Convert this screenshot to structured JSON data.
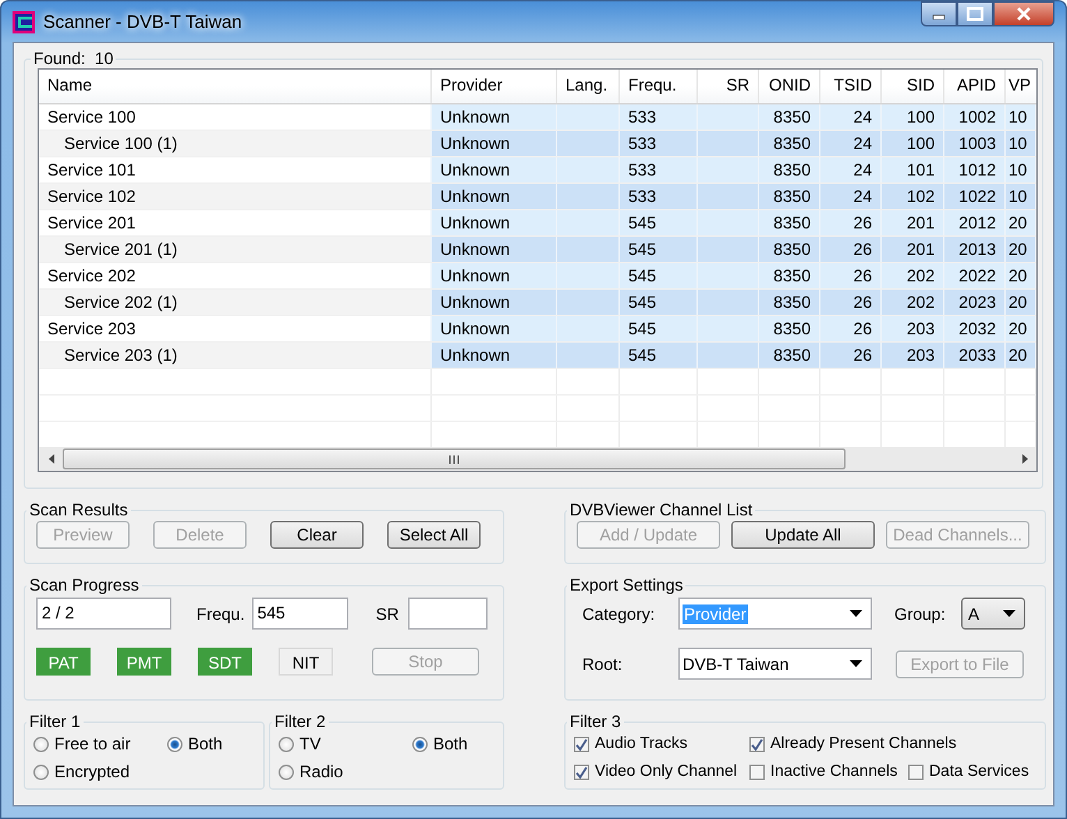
{
  "window": {
    "title": "Scanner - DVB-T Taiwan"
  },
  "found": {
    "label": "Found:",
    "count": "10"
  },
  "table": {
    "columns": [
      "Name",
      "Provider",
      "Lang.",
      "Frequ.",
      "SR",
      "ONID",
      "TSID",
      "SID",
      "APID",
      "VP"
    ],
    "rows": [
      {
        "cells": [
          "Service 100",
          "Unknown",
          "",
          "533",
          "",
          "8350",
          "24",
          "100",
          "1002",
          "10"
        ],
        "children": [
          {
            "cells": [
              "Service 100 (1)",
              "Unknown",
              "",
              "533",
              "",
              "8350",
              "24",
              "100",
              "1003",
              "10"
            ]
          }
        ]
      },
      {
        "cells": [
          "Service 101",
          "Unknown",
          "",
          "533",
          "",
          "8350",
          "24",
          "101",
          "1012",
          "10"
        ]
      },
      {
        "cells": [
          "Service 102",
          "Unknown",
          "",
          "533",
          "",
          "8350",
          "24",
          "102",
          "1022",
          "10"
        ]
      },
      {
        "cells": [
          "Service 201",
          "Unknown",
          "",
          "545",
          "",
          "8350",
          "26",
          "201",
          "2012",
          "20"
        ],
        "children": [
          {
            "cells": [
              "Service 201 (1)",
              "Unknown",
              "",
              "545",
              "",
              "8350",
              "26",
              "201",
              "2013",
              "20"
            ]
          }
        ]
      },
      {
        "cells": [
          "Service 202",
          "Unknown",
          "",
          "545",
          "",
          "8350",
          "26",
          "202",
          "2022",
          "20"
        ],
        "children": [
          {
            "cells": [
              "Service 202 (1)",
              "Unknown",
              "",
              "545",
              "",
              "8350",
              "26",
              "202",
              "2023",
              "20"
            ]
          }
        ]
      },
      {
        "cells": [
          "Service 203",
          "Unknown",
          "",
          "545",
          "",
          "8350",
          "26",
          "203",
          "2032",
          "20"
        ],
        "children": [
          {
            "cells": [
              "Service 203 (1)",
              "Unknown",
              "",
              "545",
              "",
              "8350",
              "26",
              "203",
              "2033",
              "20"
            ]
          }
        ]
      }
    ]
  },
  "scan_results": {
    "title": "Scan Results",
    "buttons": [
      {
        "label": "Preview",
        "disabled": true
      },
      {
        "label": "Delete",
        "disabled": true
      },
      {
        "label": "Clear",
        "disabled": false
      },
      {
        "label": "Select All",
        "disabled": false
      }
    ]
  },
  "channel_list": {
    "title": "DVBViewer Channel List",
    "buttons": [
      {
        "label": "Add / Update",
        "disabled": true
      },
      {
        "label": "Update All",
        "disabled": false
      },
      {
        "label": "Dead Channels...",
        "disabled": true
      }
    ]
  },
  "scan_progress": {
    "title": "Scan Progress",
    "progress": "2 / 2",
    "freq_label": "Frequ.",
    "freq_value": "545",
    "sr_label": "SR",
    "tables": [
      {
        "label": "PAT",
        "found": true
      },
      {
        "label": "PMT",
        "found": true
      },
      {
        "label": "SDT",
        "found": true
      },
      {
        "label": "NIT",
        "found": false
      }
    ],
    "stop": {
      "label": "Stop",
      "disabled": true
    }
  },
  "export_settings": {
    "title": "Export Settings",
    "category": {
      "label": "Category:",
      "value": "Provider",
      "highlighted": true
    },
    "group": {
      "label": "Group:",
      "value": "A"
    },
    "root": {
      "label": "Root:",
      "value": "DVB-T Taiwan"
    },
    "export": {
      "label": "Export to File",
      "disabled": true
    }
  },
  "filter1": {
    "title": "Filter 1",
    "options": [
      {
        "label": "Free to air",
        "selected": false
      },
      {
        "label": "Both",
        "selected": true
      },
      {
        "label": "Encrypted",
        "selected": false
      }
    ]
  },
  "filter2": {
    "title": "Filter 2",
    "options": [
      {
        "label": "TV",
        "selected": false
      },
      {
        "label": "Both",
        "selected": true
      },
      {
        "label": "Radio",
        "selected": false
      }
    ]
  },
  "filter3": {
    "title": "Filter 3",
    "options": [
      {
        "label": "Audio Tracks",
        "checked": true
      },
      {
        "label": "Already Present Channels",
        "checked": true
      },
      {
        "label": "Video Only Channel",
        "checked": true
      },
      {
        "label": "Inactive Channels",
        "checked": false
      },
      {
        "label": "Data Services",
        "checked": false
      }
    ]
  }
}
